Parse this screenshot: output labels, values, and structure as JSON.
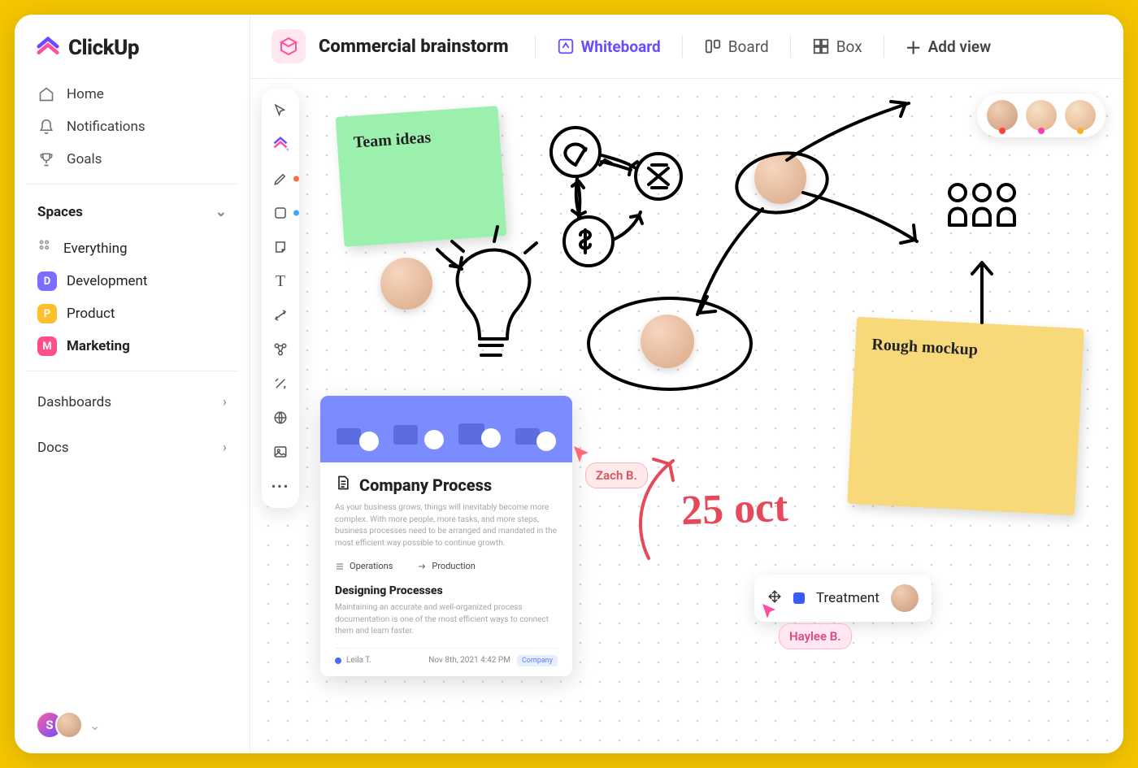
{
  "logo": {
    "text": "ClickUp"
  },
  "sidebar": {
    "nav": [
      {
        "label": "Home",
        "icon": "home"
      },
      {
        "label": "Notifications",
        "icon": "bell"
      },
      {
        "label": "Goals",
        "icon": "trophy"
      }
    ],
    "spaces_header": "Spaces",
    "everything_label": "Everything",
    "spaces": [
      {
        "letter": "D",
        "label": "Development",
        "color": "#7c6cff"
      },
      {
        "letter": "P",
        "label": "Product",
        "color": "#ffbf2b"
      },
      {
        "letter": "M",
        "label": "Marketing",
        "color": "#ff4f8b",
        "active": true
      }
    ],
    "footer": [
      {
        "label": "Dashboards"
      },
      {
        "label": "Docs"
      }
    ],
    "bottom_presence": {
      "initial": "S",
      "color_a": "#ff5fa2",
      "color_b": "#6a4cff"
    }
  },
  "topbar": {
    "title": "Commercial brainstorm",
    "tabs": [
      {
        "label": "Whiteboard",
        "icon": "edit",
        "active": true
      },
      {
        "label": "Board",
        "icon": "board"
      },
      {
        "label": "Box",
        "icon": "grid"
      }
    ],
    "add_view": "Add view"
  },
  "palette_tools": [
    "pointer",
    "logo-add",
    "pen",
    "square",
    "note",
    "text",
    "connector",
    "diagram",
    "magic",
    "globe",
    "image",
    "more"
  ],
  "palette_colors": {
    "pen": "#ff6a3d",
    "square": "#3aa6ff"
  },
  "top_presence_dots": [
    "#ff4141",
    "#ff3db4",
    "#ffad29"
  ],
  "sticky_notes": {
    "team_ideas": "Team ideas",
    "rough_mockup": "Rough mockup"
  },
  "doc_card": {
    "title": "Company Process",
    "desc": "As your business grows, things will inevitably become more complex. With more people, more tasks, and more steps, business processes need to be arranged and mandated in the most efficient way possible to continue growth.",
    "link_a": "Operations",
    "link_b": "Production",
    "subtitle": "Designing Processes",
    "sub_desc": "Maintaining an accurate and well-organized process documentation is one of the most efficient ways to connect them and learn faster.",
    "author": "Leila T.",
    "date": "Nov 8th, 2021  4:42 PM",
    "chip": "Company"
  },
  "cursors": {
    "zach": "Zach B.",
    "haylee": "Haylee B."
  },
  "task_chip": {
    "label": "Treatment"
  },
  "hand_date": "25 oct"
}
